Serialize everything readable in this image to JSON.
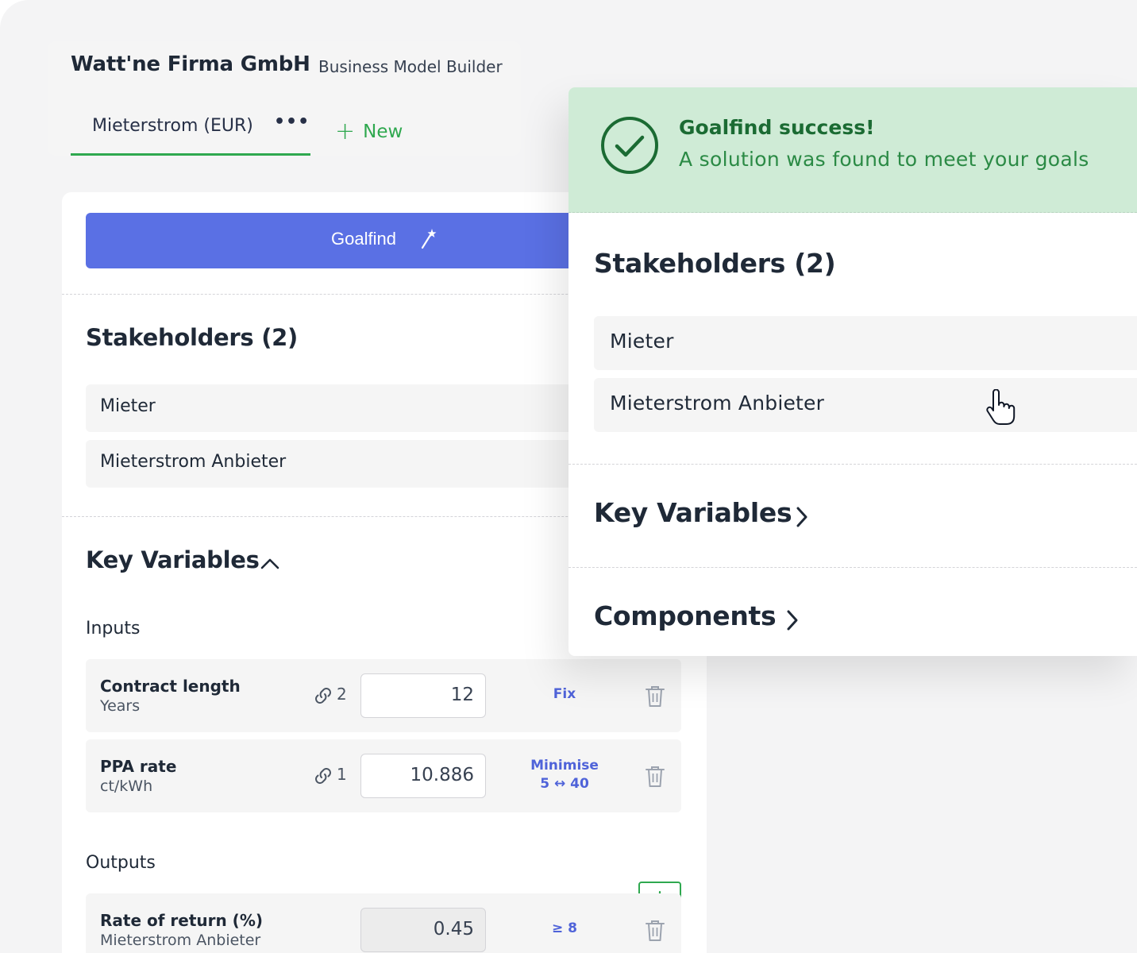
{
  "header": {
    "company": "Watt'ne Firma GmbH",
    "app_name": "Business Model Builder",
    "active_tab": "Mieterstrom (EUR)",
    "tab_menu": "•••",
    "new_tab_label": "New"
  },
  "left": {
    "goalfind_label": "Goalfind",
    "stakeholders_title": "Stakeholders (2)",
    "stakeholders": [
      "Mieter",
      "Mieterstrom Anbieter"
    ],
    "key_variables_title": "Key Variables",
    "inputs_label": "Inputs",
    "inputs": [
      {
        "name": "Contract length",
        "unit": "Years",
        "links": "2",
        "value": "12",
        "goal": "Fix",
        "goal_range": ""
      },
      {
        "name": "PPA rate",
        "unit": "ct/kWh",
        "links": "1",
        "value": "10.886",
        "goal": "Minimise",
        "goal_range": "5 ↔ 40"
      }
    ],
    "outputs_label": "Outputs",
    "outputs": [
      {
        "name": "Rate of return (%)",
        "unit": "Mieterstrom Anbieter",
        "value": "0.45",
        "goal": "≥ 8"
      }
    ]
  },
  "panel": {
    "banner_title": "Goalfind success!",
    "banner_message": "A solution was found to meet your goals",
    "stakeholders_title": "Stakeholders (2)",
    "stakeholders": [
      "Mieter",
      "Mieterstrom Anbieter"
    ],
    "key_variables_title": "Key Variables",
    "components_title": "Components"
  },
  "colors": {
    "accent_green": "#2fa84f",
    "goalfind_blue": "#5a70e4",
    "success_bg": "#cfebd6",
    "success_text": "#1b6b33",
    "link_blue": "#4f63d9"
  },
  "icons": [
    "more-dots-icon",
    "plus-icon",
    "magic-wand-icon",
    "chevron-up-icon",
    "link-icon",
    "trash-icon",
    "check-circle-icon",
    "chevron-right-icon",
    "hand-pointer-icon"
  ]
}
